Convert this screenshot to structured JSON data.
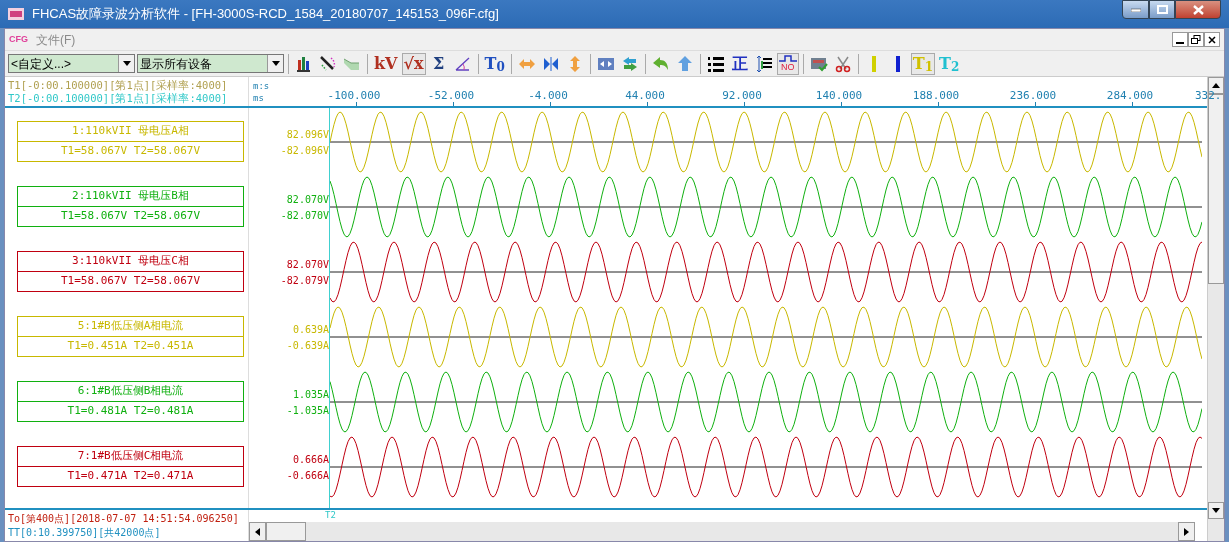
{
  "window": {
    "title": "FHCAS故障录波分析软件 - [FH-3000S-RCD_1584_20180707_145153_096F.cfg]"
  },
  "menu": {
    "logo": "CFG",
    "items": [
      {
        "label": "文件(F)",
        "disabled": true
      }
    ]
  },
  "toolbar": [
    {
      "kind": "dropdown",
      "value": "<自定义...>"
    },
    {
      "kind": "dropdown",
      "value": "显示所有设备"
    },
    {
      "kind": "sep"
    },
    {
      "kind": "icon",
      "selected": false
    },
    {
      "kind": "icon",
      "selected": false
    },
    {
      "kind": "icon",
      "selected": false
    },
    {
      "kind": "sep"
    },
    {
      "kind": "text",
      "label": "kV",
      "color": "#b03020",
      "selected": false
    },
    {
      "kind": "text",
      "label": "√x",
      "color": "#b03020",
      "selected": true
    },
    {
      "kind": "text",
      "label": "Σ",
      "color": "#204080",
      "selected": false
    },
    {
      "kind": "icon",
      "selected": false
    },
    {
      "kind": "sep"
    },
    {
      "kind": "text",
      "label": "T$_{0}$",
      "color": "#2050c0",
      "selected": false
    },
    {
      "kind": "sep"
    },
    {
      "kind": "icon",
      "selected": false
    },
    {
      "kind": "icon",
      "selected": false
    },
    {
      "kind": "icon",
      "selected": false
    },
    {
      "kind": "sep"
    },
    {
      "kind": "icon",
      "selected": false
    },
    {
      "kind": "icon",
      "selected": false
    },
    {
      "kind": "sep"
    },
    {
      "kind": "icon",
      "selected": false
    },
    {
      "kind": "icon",
      "selected": false
    },
    {
      "kind": "sep"
    },
    {
      "kind": "icon",
      "selected": false
    },
    {
      "kind": "text",
      "label": "正",
      "color": "#2030c0",
      "selected": false
    },
    {
      "kind": "icon",
      "selected": false
    },
    {
      "kind": "pulse",
      "label": "NO",
      "selected": true
    },
    {
      "kind": "sep"
    },
    {
      "kind": "icon",
      "selected": false
    },
    {
      "kind": "icon",
      "selected": false
    },
    {
      "kind": "sep"
    },
    {
      "kind": "icon",
      "selected": false
    },
    {
      "kind": "icon",
      "selected": false
    },
    {
      "kind": "text",
      "label": "T$_{1}$",
      "color": "#d0c000",
      "selected": true
    },
    {
      "kind": "text",
      "label": "T$_{2}$",
      "color": "#20c0d0",
      "selected": false
    }
  ],
  "cursor_info": [
    {
      "text": "T1[-0:00.100000][第1点][采样率:4000]",
      "color": "#b0a050"
    },
    {
      "text": "T2[-0:00.100000][第1点][采样率:4000]",
      "color": "#30c8c8"
    }
  ],
  "axis": {
    "unit_top": "m:s",
    "unit_bottom": "ms",
    "ticks": [
      "-100.000",
      "-52.000",
      "-4.000",
      "44.000",
      "92.000",
      "140.000",
      "188.000",
      "236.000",
      "284.000",
      "332."
    ]
  },
  "channels": [
    {
      "label": "1:110kVII 母电压A相",
      "readout": "T1=58.067V T2=58.067V",
      "max": "82.096V",
      "min": "-82.096V",
      "color": "#c8b800"
    },
    {
      "label": "2:110kVII 母电压B相",
      "readout": "T1=58.067V T2=58.067V",
      "max": "82.070V",
      "min": "-82.070V",
      "color": "#10b010"
    },
    {
      "label": "3:110kVII 母电压C相",
      "readout": "T1=58.067V T2=58.067V",
      "max": "82.070V",
      "min": "-82.079V",
      "color": "#c00010"
    },
    {
      "label": "5:1#B低压侧A相电流",
      "readout": "T1=0.451A T2=0.451A",
      "max": "0.639A",
      "min": "-0.639A",
      "color": "#c8b800"
    },
    {
      "label": "6:1#B低压侧B相电流",
      "readout": "T1=0.481A T2=0.481A",
      "max": "1.035A",
      "min": "-1.035A",
      "color": "#10b010"
    },
    {
      "label": "7:1#B低压侧C相电流",
      "readout": "T1=0.471A T2=0.471A",
      "max": "0.666A",
      "min": "-0.666A",
      "color": "#c00010"
    }
  ],
  "status": [
    {
      "text": "To[第400点][2018-07-07 14:51:54.096250]",
      "color": "#c02010"
    },
    {
      "text": "TT[0:10.399750][共42000点]",
      "color": "#2090c0"
    }
  ],
  "cursor_label": "T2"
}
